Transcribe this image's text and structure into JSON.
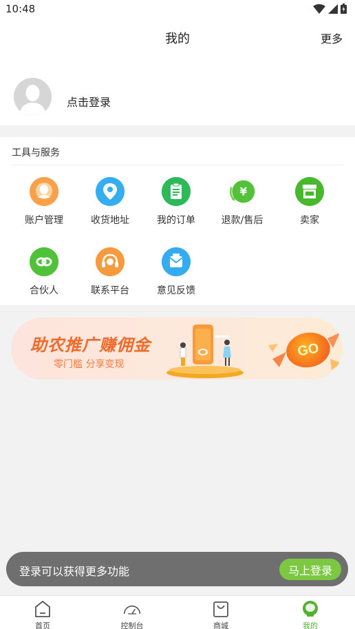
{
  "status_bar": {
    "time": "10:48"
  },
  "header": {
    "title": "我的",
    "more_label": "更多"
  },
  "profile": {
    "login_label": "点击登录"
  },
  "tools": {
    "title": "工具与服务",
    "items": [
      {
        "label": "账户管理",
        "icon": "account-icon",
        "color": "#f79a3e"
      },
      {
        "label": "收货地址",
        "icon": "location-icon",
        "color": "#2fa8ee"
      },
      {
        "label": "我的订单",
        "icon": "order-icon",
        "color": "#2fb858"
      },
      {
        "label": "退款/售后",
        "icon": "refund-icon",
        "color": "#57c23a"
      },
      {
        "label": "卖家",
        "icon": "store-icon",
        "color": "#4fb92f"
      },
      {
        "label": "合伙人",
        "icon": "partner-icon",
        "color": "#52c23a"
      },
      {
        "label": "联系平台",
        "icon": "support-icon",
        "color": "#f79a3e"
      },
      {
        "label": "意见反馈",
        "icon": "feedback-icon",
        "color": "#2fa8ee"
      }
    ]
  },
  "banner": {
    "title": "助农推广赚佣金",
    "subtitle": "零门槛 分享变现",
    "go_label": "GO"
  },
  "toast": {
    "text": "登录可以获得更多功能",
    "button_label": "马上登录"
  },
  "tabbar": {
    "items": [
      {
        "label": "首页",
        "icon": "home-icon",
        "active": false
      },
      {
        "label": "控制台",
        "icon": "dashboard-icon",
        "active": false
      },
      {
        "label": "商城",
        "icon": "shop-bag-icon",
        "active": false
      },
      {
        "label": "我的",
        "icon": "profile-icon",
        "active": true
      }
    ]
  },
  "colors": {
    "accent": "#7cc843",
    "active_tab": "#52b131",
    "banner_text": "#f06a2a"
  }
}
